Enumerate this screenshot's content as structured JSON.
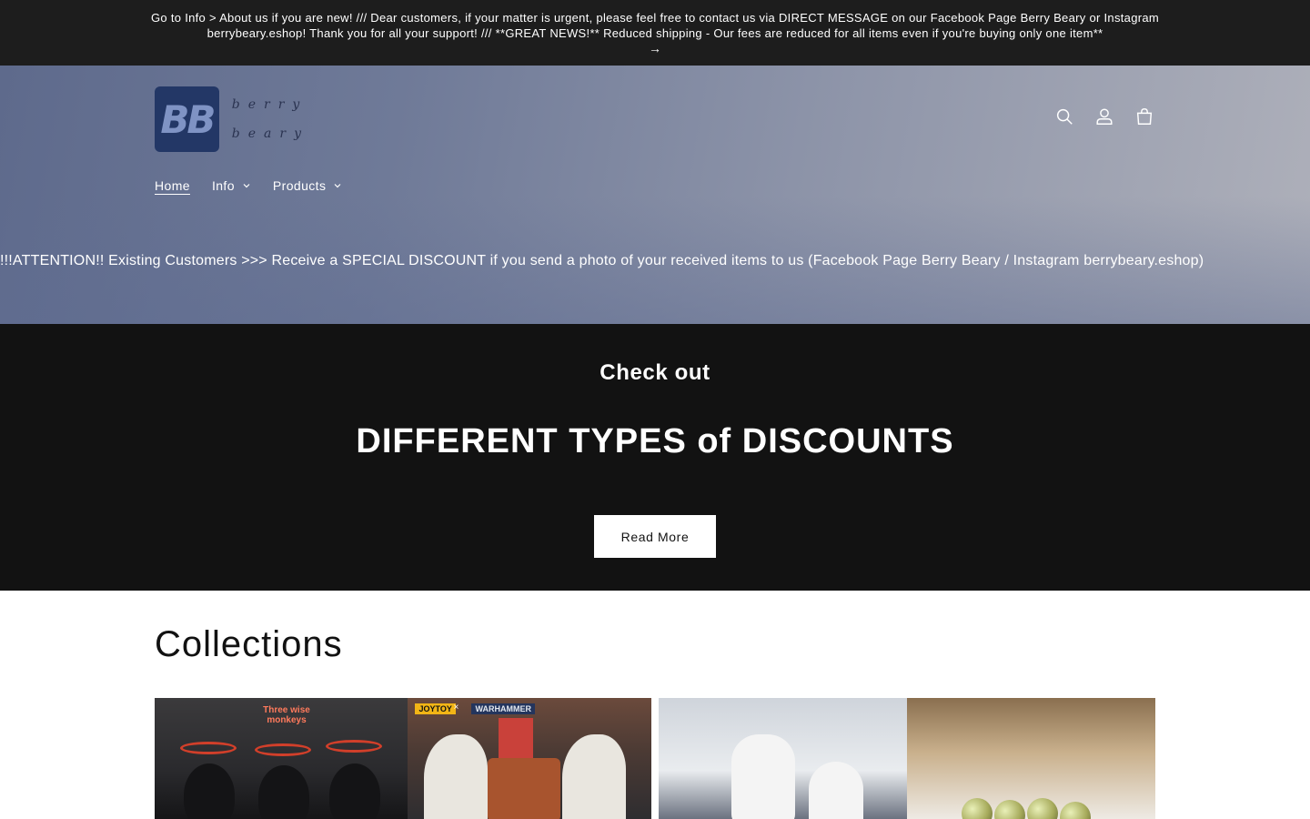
{
  "announcement": {
    "text": "Go to Info > About us if you are new! /// Dear customers, if your matter is urgent, please feel free to contact us via DIRECT MESSAGE on our Facebook Page Berry Beary or Instagram berrybeary.eshop! Thank you for all your support! /// **GREAT NEWS!** Reduced shipping - Our fees are reduced for all items even if you're buying only one item**",
    "arrow": "→"
  },
  "header": {
    "logo": {
      "mark": "BB",
      "word1": "berry",
      "word2": "beary"
    },
    "icons": [
      "search-icon",
      "account-icon",
      "cart-icon"
    ],
    "nav": [
      {
        "label": "Home",
        "active": true
      },
      {
        "label": "Info",
        "dropdown": true
      },
      {
        "label": "Products",
        "dropdown": true
      }
    ],
    "marquee": "!!!ATTENTION!! Existing Customers >>> Receive a SPECIAL DISCOUNT if you send a photo of your received items to us (Facebook Page Berry Beary / Instagram berrybeary.eshop)"
  },
  "promo": {
    "subheading": "Check out",
    "heading": "DIFFERENT TYPES of DISCOUNTS",
    "button_label": "Read More"
  },
  "collections": {
    "title": "Collections",
    "tile1": {
      "label_small": "",
      "label_red": "Three wise monkeys",
      "badge_joytoy": "JOYTOY",
      "badge_x": "×",
      "badge_warhammer": "WARHAMMER"
    }
  },
  "colors": {
    "announcement_bg": "#1d1d1d",
    "promo_bg": "#121212",
    "logo_bg": "#233766",
    "text_white": "#ffffff"
  }
}
